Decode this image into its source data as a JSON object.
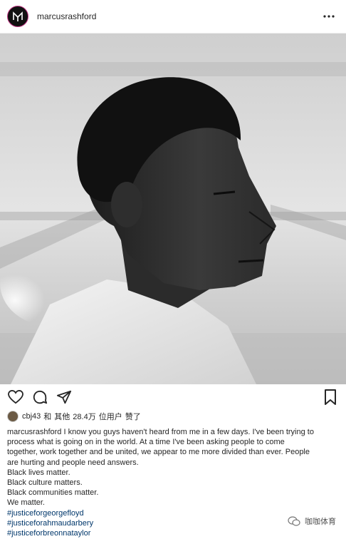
{
  "post": {
    "username": "marcusrashford",
    "liked_by": {
      "user": "cbj43",
      "and": "和",
      "others": "其他",
      "count": "28.4万",
      "users_suffix": "位用户",
      "liked": "赞了"
    },
    "caption_lines": [
      "marcusrashford I know you guys haven't heard from me in a few days. I've been trying to",
      "process what is going on in the world. At a time I've been asking people to come",
      "together, work together and be united, we appear to me more divided than ever. People",
      "are hurting and people need answers.",
      "Black lives matter.",
      "Black culture matters.",
      "Black communities matter.",
      "We matter."
    ],
    "hashtags": [
      "#justiceforgeorgefloyd",
      "#justiceforahmaudarbery",
      "#justiceforbreonnataylor"
    ]
  },
  "icons": {
    "more": "more-dots-icon",
    "like": "heart-icon",
    "comment": "comment-icon",
    "share": "share-icon",
    "save": "bookmark-icon"
  },
  "watermark": {
    "text": "咖咖体育"
  },
  "colors": {
    "text": "#262626",
    "hashtag": "#00376b",
    "avatar_ring": "#c13584"
  }
}
